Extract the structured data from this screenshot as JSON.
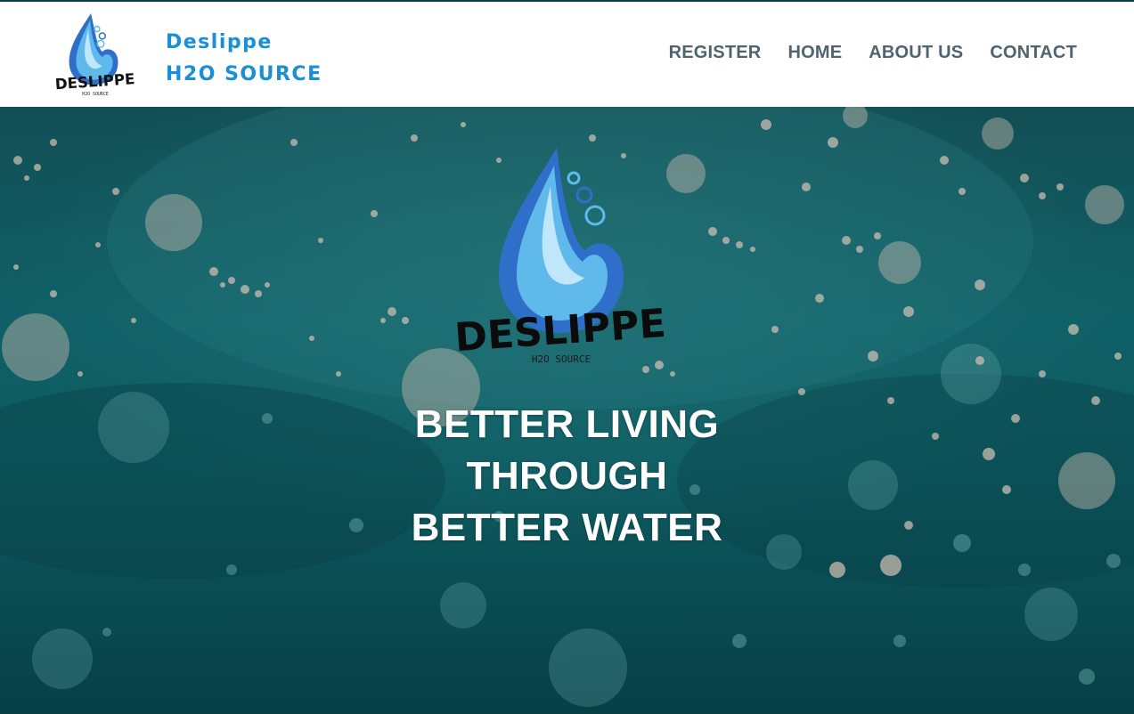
{
  "header": {
    "brand_line1": "Deslippe",
    "brand_line2": "H2O SOURCE",
    "logo": {
      "wordmark": "DESLIPPE",
      "subtext": "H2O SOURCE"
    }
  },
  "nav": {
    "items": [
      {
        "label": "REGISTER"
      },
      {
        "label": "HOME"
      },
      {
        "label": "ABOUT US"
      },
      {
        "label": "CONTACT"
      }
    ]
  },
  "hero": {
    "logo": {
      "wordmark": "DESLIPPE",
      "subtext": "H2O SOURCE"
    },
    "tagline": [
      "BETTER LIVING",
      "THROUGH",
      "BETTER WATER"
    ]
  },
  "colors": {
    "brand_blue": "#1a8fd6",
    "nav_gray": "#4f6471",
    "water_teal": "#0f6066",
    "drop_light": "#5fb9ea",
    "drop_dark": "#2f6fc9"
  }
}
